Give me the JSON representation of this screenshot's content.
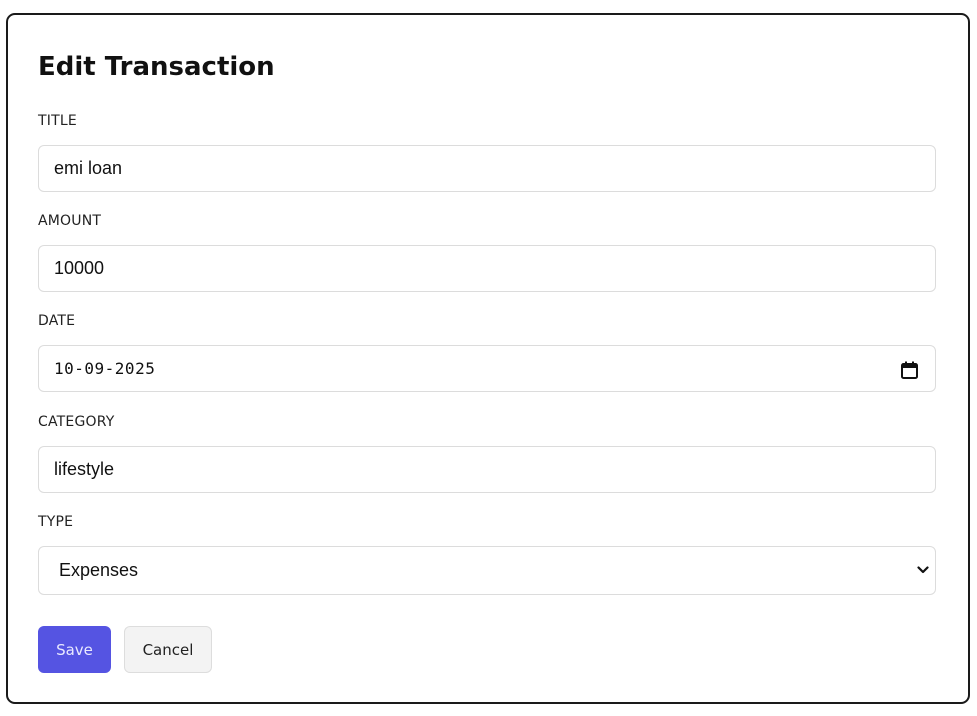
{
  "form": {
    "heading": "Edit Transaction",
    "fields": {
      "title": {
        "label": "TITLE",
        "value": "emi loan"
      },
      "amount": {
        "label": "AMOUNT",
        "value": "10000"
      },
      "date": {
        "label": "DATE",
        "value": "10-09-2025",
        "icon": "calendar-icon"
      },
      "category": {
        "label": "CATEGORY",
        "value": "lifestyle"
      },
      "type": {
        "label": "TYPE",
        "value": "Expenses",
        "icon": "chevron-down-icon"
      }
    },
    "actions": {
      "save_label": "Save",
      "cancel_label": "Cancel"
    }
  },
  "colors": {
    "accent": "#5554e2",
    "border": "#1a1a1a",
    "input_border": "#dcdcdc",
    "cancel_bg": "#f3f3f3"
  }
}
